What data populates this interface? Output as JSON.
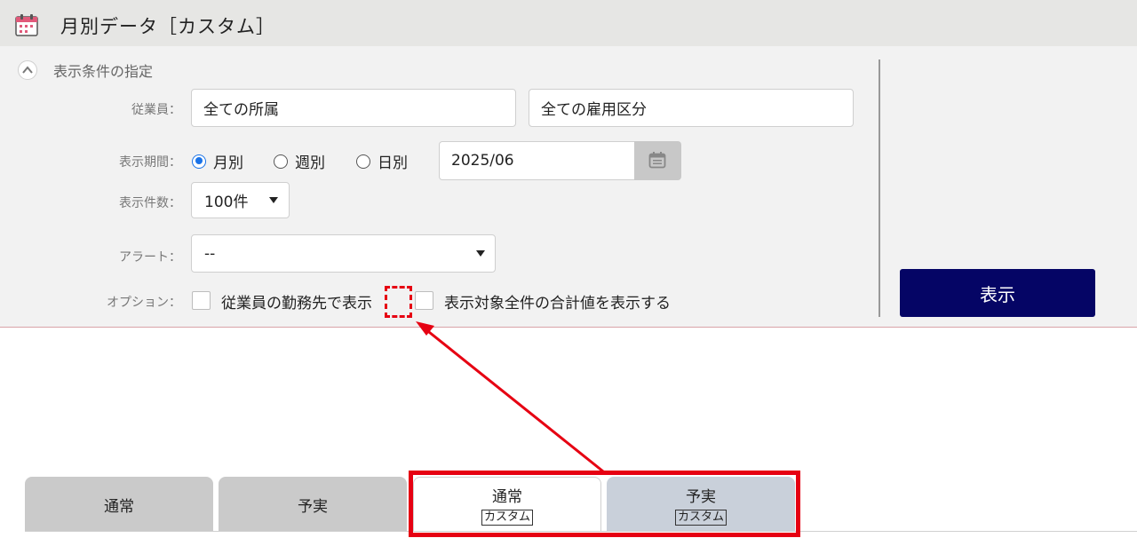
{
  "header": {
    "title": "月別データ［カスタム］",
    "icon": "calendar-icon"
  },
  "conditions": {
    "section_title": "表示条件の指定",
    "employee": {
      "label": "従業員：",
      "affiliation_value": "全ての所属",
      "employment_value": "全ての雇用区分"
    },
    "period": {
      "label": "表示期間：",
      "options": [
        "月別",
        "週別",
        "日別"
      ],
      "selected": "月別",
      "date_value": "2025/06"
    },
    "count": {
      "label": "表示件数：",
      "value": "100件"
    },
    "alert": {
      "label": "アラート：",
      "value": "--"
    },
    "options": {
      "label": "オプション：",
      "items": [
        "従業員の勤務先で表示",
        "表示対象全件の合計値を表示する"
      ]
    },
    "show_button": "表示"
  },
  "tabs": [
    {
      "label": "通常",
      "badge": ""
    },
    {
      "label": "予実",
      "badge": ""
    },
    {
      "label": "通常",
      "badge": "カスタム"
    },
    {
      "label": "予実",
      "badge": "カスタム"
    }
  ],
  "colors": {
    "primary_button": "#050565",
    "radio_selected": "#1a73e8",
    "annotation_red": "#e60012"
  }
}
